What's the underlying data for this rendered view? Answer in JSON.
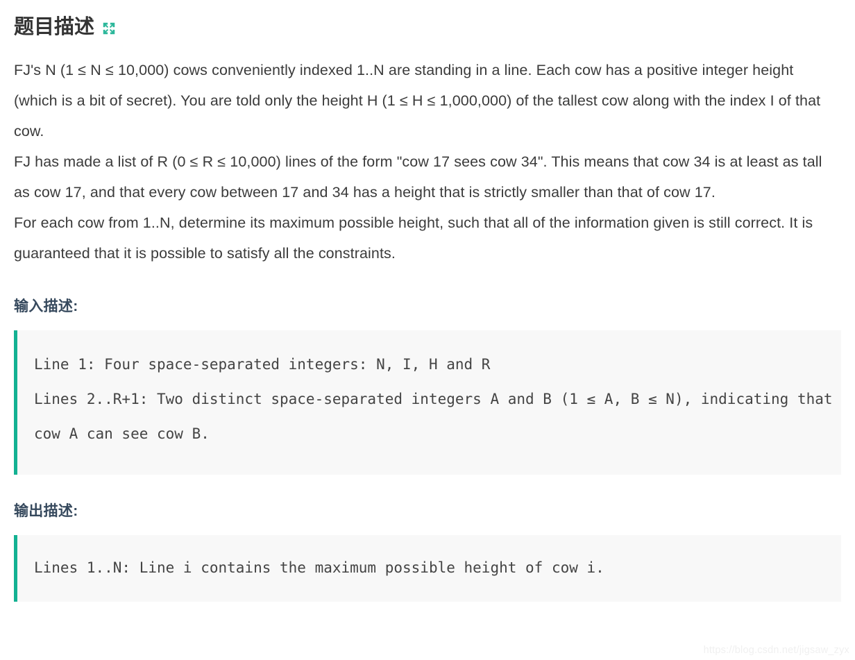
{
  "header": {
    "title": "题目描述",
    "expand_icon": "expand-arrows-icon",
    "icon_color": "#2bb79a",
    "title_color": "#333333"
  },
  "description": {
    "paragraphs": [
      "FJ's N (1 ≤ N ≤ 10,000) cows conveniently indexed 1..N are standing in a line. Each cow has a positive integer height (which is a bit of secret). You are told only the height H (1 ≤ H ≤ 1,000,000) of the tallest cow along with the index I of that cow.",
      "FJ has made a list of R (0 ≤ R ≤ 10,000) lines of the form \"cow 17 sees cow 34\". This means that cow 34 is at least as tall as cow 17, and that every cow between 17 and 34 has a height that is strictly smaller than that of cow 17.",
      "For each cow from 1..N, determine its maximum possible height, such that all of the information given is still correct. It is guaranteed that it is possible to satisfy all the constraints."
    ]
  },
  "input_section": {
    "heading": "输入描述:",
    "heading_color": "#36495d",
    "code": "Line 1: Four space-separated integers: N, I, H and R\nLines 2..R+1: Two distinct space-separated integers A and B (1 ≤ A, B ≤ N), indicating that cow A can see cow B.",
    "accent_color": "#13b192",
    "background_color": "#f8f8f8"
  },
  "output_section": {
    "heading": "输出描述:",
    "heading_color": "#36495d",
    "code": "Lines 1..N: Line i contains the maximum possible height of cow i.",
    "accent_color": "#13b192",
    "background_color": "#f8f8f8"
  },
  "watermark": {
    "text": "https://blog.csdn.net/jigsaw_zyx"
  }
}
